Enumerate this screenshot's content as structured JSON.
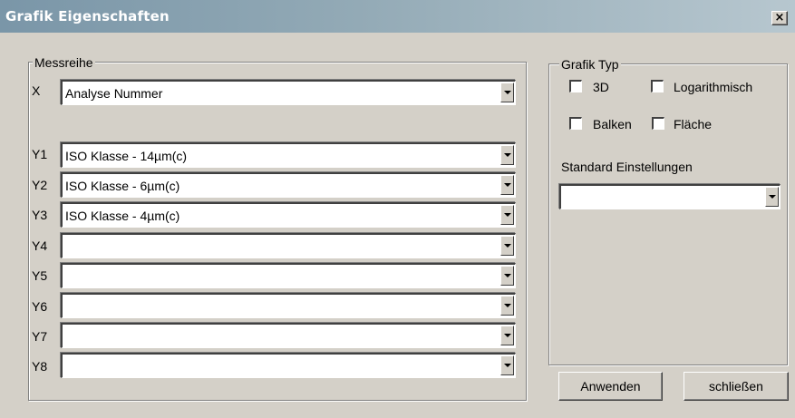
{
  "window": {
    "title": "Grafik Eigenschaften",
    "close_label": "×"
  },
  "messreihe": {
    "legend": "Messreihe",
    "rows": [
      {
        "label": "X",
        "value": ""
      },
      {
        "label": "Y1",
        "value": ""
      },
      {
        "label": "Y2",
        "value": ""
      },
      {
        "label": "Y3",
        "value": ""
      },
      {
        "label": "Y4",
        "value": ""
      },
      {
        "label": "Y5",
        "value": ""
      },
      {
        "label": "Y6",
        "value": ""
      },
      {
        "label": "Y7",
        "value": ""
      },
      {
        "label": "Y8",
        "value": ""
      }
    ],
    "x_value": "Analyse Nummer",
    "y1_value": "ISO Klasse  - 14µm(c)",
    "y2_value": "ISO Klasse  - 6µm(c)",
    "y3_value": "ISO Klasse  - 4µm(c)"
  },
  "grafik_typ": {
    "legend": "Grafik Typ",
    "options": {
      "three_d": {
        "label": "3D",
        "checked": false
      },
      "logarithmisch": {
        "label": "Logarithmisch",
        "checked": false
      },
      "balken": {
        "label": "Balken",
        "checked": false
      },
      "flaeche": {
        "label": "Fläche",
        "checked": false
      }
    },
    "standard_label": "Standard Einstellungen",
    "standard_value": ""
  },
  "buttons": {
    "apply": "Anwenden",
    "close": "schließen"
  },
  "icons": {
    "close": "close-icon",
    "dropdown": "chevron-down-icon"
  }
}
